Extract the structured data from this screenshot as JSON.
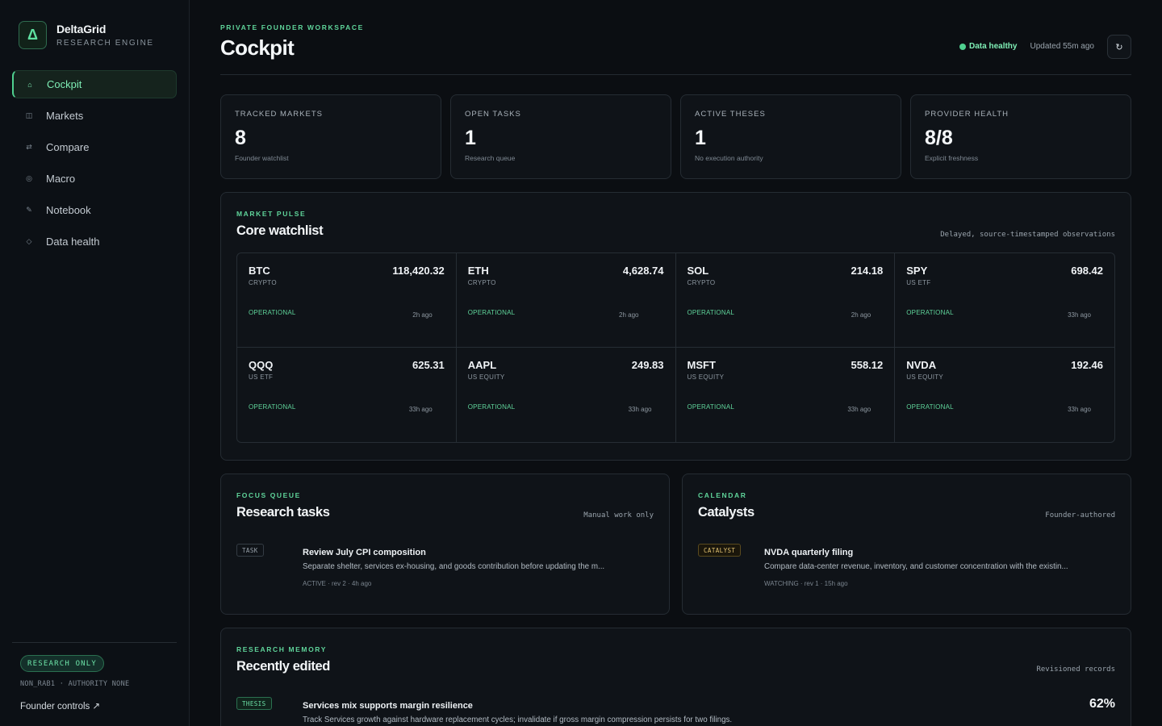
{
  "brand": {
    "logo_glyph": "Δ",
    "name": "DeltaGrid",
    "subtitle": "RESEARCH ENGINE"
  },
  "nav": [
    {
      "label": "Cockpit",
      "icon": "home-icon",
      "glyph": "⌂",
      "active": true
    },
    {
      "label": "Markets",
      "icon": "markets-icon",
      "glyph": "◫"
    },
    {
      "label": "Compare",
      "icon": "compare-icon",
      "glyph": "⇄"
    },
    {
      "label": "Macro",
      "icon": "macro-icon",
      "glyph": "◎"
    },
    {
      "label": "Notebook",
      "icon": "notebook-icon",
      "glyph": "✎"
    },
    {
      "label": "Data health",
      "icon": "data-health-icon",
      "glyph": "◇"
    }
  ],
  "sidebar_footer": {
    "badge": "RESEARCH ONLY",
    "meta": "NON_RAB1 · AUTHORITY NONE",
    "founder_link": "Founder controls ↗"
  },
  "header": {
    "eyebrow": "PRIVATE FOUNDER WORKSPACE",
    "title": "Cockpit",
    "status": "Data healthy",
    "updated": "Updated 55m ago",
    "refresh_glyph": "↻"
  },
  "stats": [
    {
      "label": "TRACKED MARKETS",
      "value": "8",
      "sub": "Founder watchlist"
    },
    {
      "label": "OPEN TASKS",
      "value": "1",
      "sub": "Research queue"
    },
    {
      "label": "ACTIVE THESES",
      "value": "1",
      "sub": "No execution authority"
    },
    {
      "label": "PROVIDER HEALTH",
      "value": "8/8",
      "sub": "Explicit freshness"
    }
  ],
  "watchlist": {
    "eyebrow": "MARKET PULSE",
    "title": "Core watchlist",
    "note": "Delayed, source-timestamped observations",
    "items": [
      {
        "symbol": "BTC",
        "class": "CRYPTO",
        "price": "118,420.32",
        "status": "OPERATIONAL",
        "age": "2h ago"
      },
      {
        "symbol": "ETH",
        "class": "CRYPTO",
        "price": "4,628.74",
        "status": "OPERATIONAL",
        "age": "2h ago"
      },
      {
        "symbol": "SOL",
        "class": "CRYPTO",
        "price": "214.18",
        "status": "OPERATIONAL",
        "age": "2h ago"
      },
      {
        "symbol": "SPY",
        "class": "US ETF",
        "price": "698.42",
        "status": "OPERATIONAL",
        "age": "33h ago"
      },
      {
        "symbol": "QQQ",
        "class": "US ETF",
        "price": "625.31",
        "status": "OPERATIONAL",
        "age": "33h ago"
      },
      {
        "symbol": "AAPL",
        "class": "US EQUITY",
        "price": "249.83",
        "status": "OPERATIONAL",
        "age": "33h ago"
      },
      {
        "symbol": "MSFT",
        "class": "US EQUITY",
        "price": "558.12",
        "status": "OPERATIONAL",
        "age": "33h ago"
      },
      {
        "symbol": "NVDA",
        "class": "US EQUITY",
        "price": "192.46",
        "status": "OPERATIONAL",
        "age": "33h ago"
      }
    ]
  },
  "tasks": {
    "eyebrow": "FOCUS QUEUE",
    "title": "Research tasks",
    "note": "Manual work only",
    "item": {
      "tag": "TASK",
      "title": "Review July CPI composition",
      "desc": "Separate shelter, services ex-housing, and goods contribution before updating the m...",
      "meta": "ACTIVE · rev 2 · 4h ago"
    }
  },
  "catalysts": {
    "eyebrow": "CALENDAR",
    "title": "Catalysts",
    "note": "Founder-authored",
    "item": {
      "tag": "CATALYST",
      "title": "NVDA quarterly filing",
      "desc": "Compare data-center revenue, inventory, and customer concentration with the existin...",
      "meta": "WATCHING · rev 1 · 15h ago"
    }
  },
  "memory": {
    "eyebrow": "RESEARCH MEMORY",
    "title": "Recently edited",
    "note": "Revisioned records",
    "item": {
      "tag": "THESIS",
      "title": "Services mix supports margin resilience",
      "desc": "Track Services growth against hardware replacement cycles; invalidate if gross margin compression persists for two filings.",
      "confidence": "62%"
    }
  },
  "colors": {
    "accent": "#4fd08f",
    "background": "#0b0e12",
    "card": "#0f1318",
    "catalyst": "#e0c170"
  }
}
